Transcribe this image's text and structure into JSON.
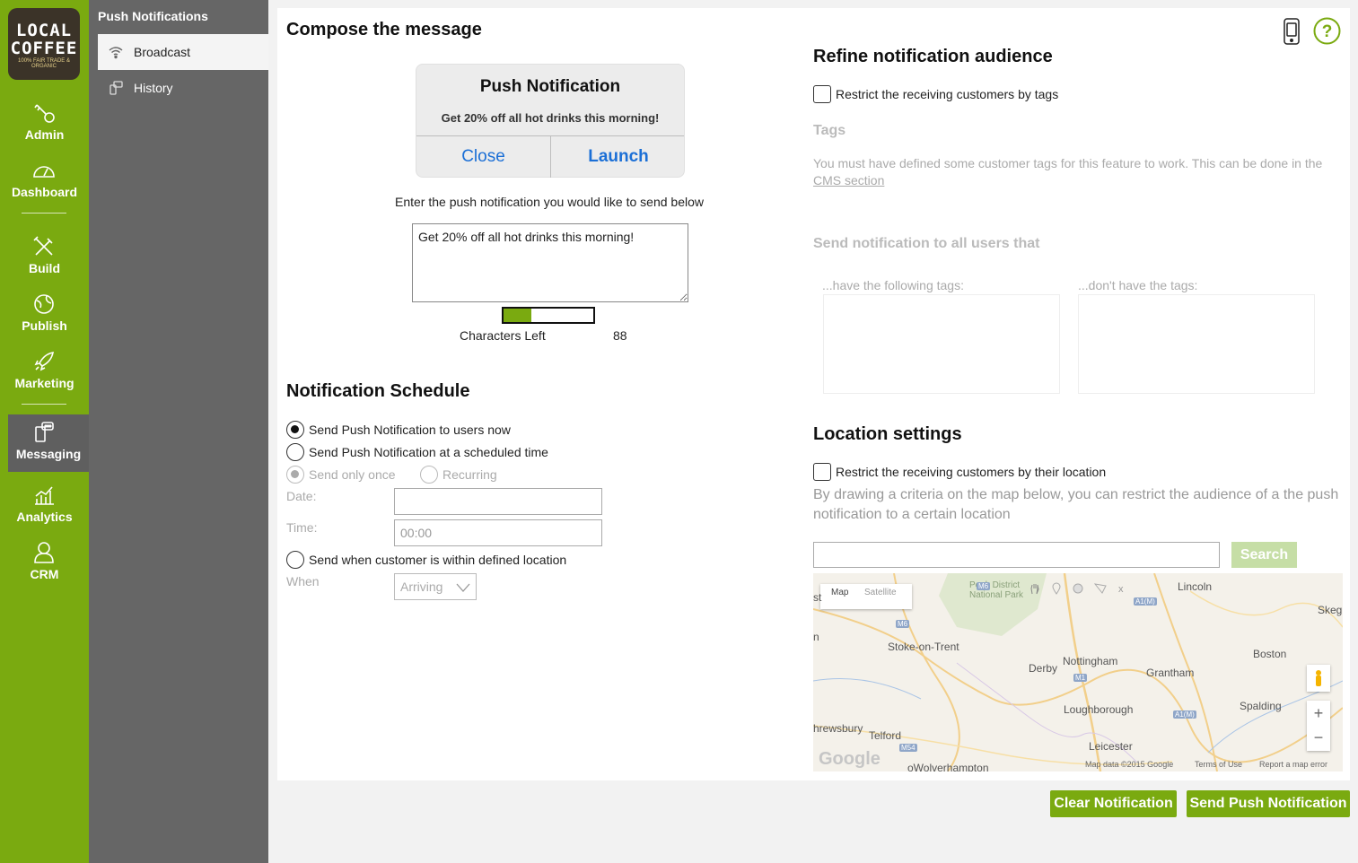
{
  "logo": {
    "line1": "LOCAL",
    "line2": "COFFEE",
    "tagline": "100% FAIR TRADE & ORGANIC"
  },
  "rail": {
    "items": [
      {
        "label": "Admin"
      },
      {
        "label": "Dashboard"
      },
      {
        "label": "Build"
      },
      {
        "label": "Publish"
      },
      {
        "label": "Marketing"
      },
      {
        "label": "Messaging"
      },
      {
        "label": "Analytics"
      },
      {
        "label": "CRM"
      }
    ],
    "active": "Messaging"
  },
  "sidebar": {
    "title": "Push Notifications",
    "items": [
      {
        "label": "Broadcast",
        "active": true
      },
      {
        "label": "History",
        "active": false
      }
    ]
  },
  "compose": {
    "heading": "Compose the message",
    "preview": {
      "title": "Push Notification",
      "message": "Get 20% off all hot drinks this morning!",
      "close_label": "Close",
      "launch_label": "Launch"
    },
    "instruction": "Enter the push notification you would like to send below",
    "message_value": "Get 20% off all hot drinks this morning!",
    "chars_left_label": "Characters Left",
    "chars_left": "88",
    "char_usage_fraction": 0.31
  },
  "schedule": {
    "heading": "Notification Schedule",
    "options": [
      {
        "label": "Send Push Notification to users now",
        "selected": true
      },
      {
        "label": "Send Push Notification at a scheduled time",
        "selected": false
      }
    ],
    "send_once_label": "Send only once",
    "recurring_label": "Recurring",
    "date_label": "Date:",
    "date_value": "",
    "time_label": "Time:",
    "time_value": "00:00",
    "location_option_label": "Send when customer is within defined location",
    "when_label": "When",
    "when_value": "Arriving"
  },
  "audience": {
    "heading": "Refine notification audience",
    "restrict_tags_label": "Restrict the receiving customers by tags",
    "tags_heading": "Tags",
    "tags_info": "You must have defined some customer tags for this feature to work. This can be done in the",
    "cms_link": "CMS section",
    "send_all_heading": "Send notification to all users that",
    "have_tags_label": "...have the following tags:",
    "dont_have_tags_label": "...don't have the tags:"
  },
  "location": {
    "heading": "Location settings",
    "restrict_location_label": "Restrict the receiving customers by their location",
    "info": "By drawing a criteria on the map below, you can restrict the audience of a the push notification to a certain location",
    "search_value": "",
    "search_label": "Search",
    "map": {
      "tab_map": "Map",
      "tab_satellite": "Satellite",
      "close": "x",
      "places": [
        "Peak District National Park",
        "Lincoln",
        "Skeg",
        "Stoke-on-Trent",
        "Nottingham",
        "Derby",
        "Grantham",
        "Boston",
        "Loughborough",
        "Spalding",
        "hrewsbury",
        "Telford",
        "Leicester",
        "oWolverhampton",
        "st",
        "n"
      ],
      "roads": [
        "M6",
        "M1",
        "A1(M)",
        "A1(M)",
        "M6",
        "M54"
      ],
      "attribution": "Map data ©2015 Google",
      "terms": "Terms of Use",
      "report": "Report a map error",
      "google": "Google"
    }
  },
  "actions": {
    "clear_label": "Clear Notification",
    "send_label": "Send Push Notification"
  },
  "colors": {
    "brand_green": "#7aaa10",
    "sidebar_gray": "#666666",
    "link_blue": "#1b6fd6"
  }
}
